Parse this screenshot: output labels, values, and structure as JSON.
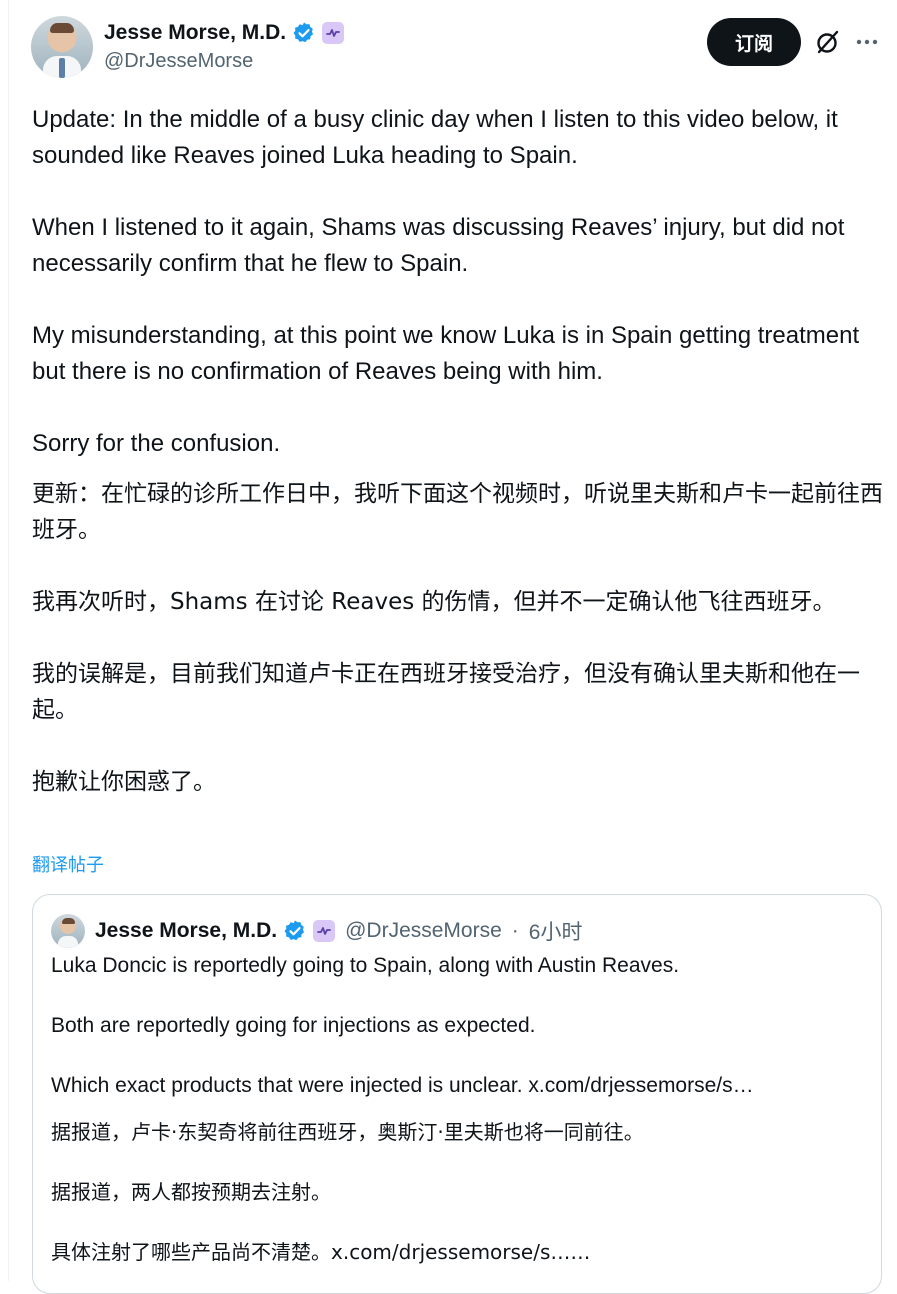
{
  "post": {
    "author_name": "Jesse Morse, M.D.",
    "handle": "@DrJesseMorse",
    "subscribe_label": "订阅",
    "text_en": [
      "Update: In the middle of a busy clinic day when I listen to this video below, it sounded like Reaves joined Luka heading to Spain.",
      "When I listened to it again, Shams was discussing Reaves’ injury, but did not necessarily confirm that he flew to Spain.",
      "My misunderstanding, at this point we know Luka is in Spain getting treatment but there is no confirmation of Reaves being with him.",
      "Sorry for the confusion."
    ],
    "text_zh": [
      "更新：在忙碌的诊所工作日中，我听下面这个视频时，听说里夫斯和卢卡一起前往西班牙。",
      "我再次听时，Shams 在讨论 Reaves 的伤情，但并不一定确认他飞往西班牙。",
      "我的误解是，目前我们知道卢卡正在西班牙接受治疗，但没有确认里夫斯和他在一起。",
      "抱歉让你困惑了。"
    ],
    "translate_link": "翻译帖子"
  },
  "quoted": {
    "author_name": "Jesse Morse, M.D.",
    "handle": "@DrJesseMorse",
    "separator": "·",
    "time": "6小时",
    "text_en": [
      "Luka Doncic is reportedly going to Spain, along with Austin Reaves.",
      "Both are reportedly going for injections as expected.",
      "Which exact products that were injected is unclear. x.com/drjessemorse/s…"
    ],
    "text_zh": [
      "据报道，卢卡·东契奇将前往西班牙，奥斯汀·里夫斯也将一同前往。",
      "据报道，两人都按预期去注射。",
      "具体注射了哪些产品尚不清楚。x.com/drjessemorse/s……"
    ]
  },
  "colors": {
    "text": "#0f1419",
    "secondary": "#536471",
    "link": "#1d9bf0",
    "verified": "#1d9bf0",
    "button_bg": "#0f1419",
    "border": "#cfd9de"
  },
  "icons": {
    "verified": "verified-badge-icon",
    "subscription": "premium-badge-icon",
    "grok": "grok-icon",
    "more": "more-icon"
  }
}
